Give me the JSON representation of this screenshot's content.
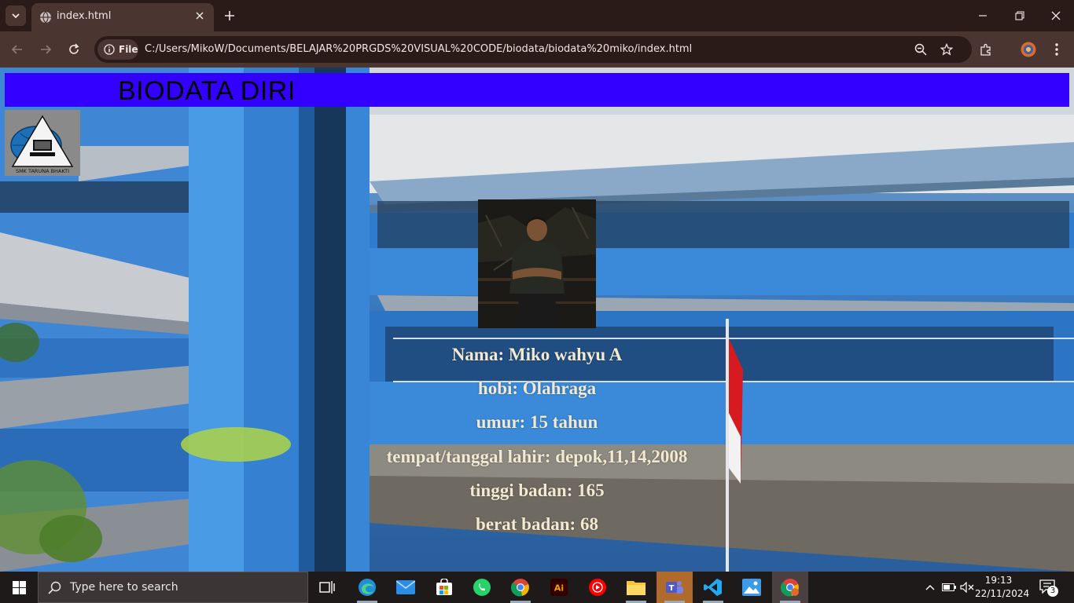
{
  "browser": {
    "tab_title": "index.html",
    "url_chip": "File",
    "url": "C:/Users/MikoW/Documents/BELAJAR%20PRGDS%20VISUAL%20CODE/biodata/biodata%20miko/index.html"
  },
  "page": {
    "header_title": "BIODATA DIRI",
    "logo_text": "SMK TARUNA BHAKTI",
    "info": [
      {
        "text": "Nama: Miko wahyu A"
      },
      {
        "text": "hobi: Olahraga"
      },
      {
        "text": "umur: 15 tahun"
      },
      {
        "text": "tempat/tanggal lahir: depok,11,14,2008"
      },
      {
        "text": "tinggi badan: 165"
      },
      {
        "text": "berat badan: 68"
      }
    ]
  },
  "taskbar": {
    "search_placeholder": "Type here to search",
    "time": "19:13",
    "date": "22/11/2024",
    "notification_count": "3",
    "apps": [
      "task-view",
      "edge",
      "mail",
      "store",
      "whatsapp",
      "chrome",
      "illustrator",
      "youtube-music",
      "file-explorer",
      "teams",
      "vscode",
      "photos",
      "chrome-active"
    ]
  },
  "colors": {
    "header_bg": "#3300ff",
    "info_text": "#f3e8d0",
    "chrome_frame": "#2b1b18",
    "chrome_toolbar": "#4a3531"
  }
}
